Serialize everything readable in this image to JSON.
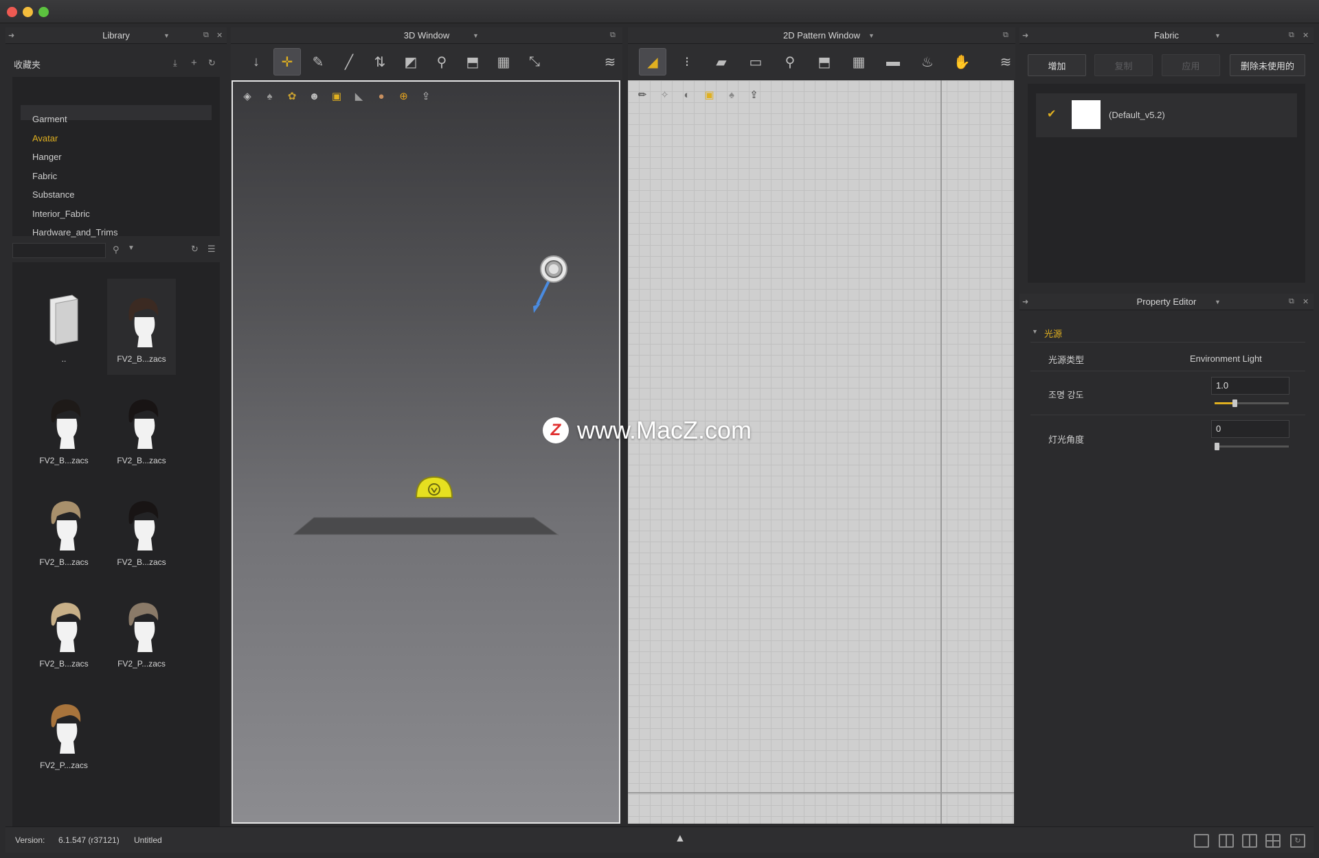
{
  "library": {
    "title": "Library",
    "favorites_label": "收藏夹",
    "categories": [
      "Garment",
      "Avatar",
      "Hanger",
      "Fabric",
      "Substance",
      "Interior_Fabric",
      "Hardware_and_Trims"
    ],
    "selected_category": "Avatar",
    "search_placeholder": "",
    "items": [
      {
        "label": ".."
      },
      {
        "label": "FV2_B...zacs"
      },
      {
        "label": "FV2_B...zacs"
      },
      {
        "label": "FV2_B...zacs"
      },
      {
        "label": "FV2_B...zacs"
      },
      {
        "label": "FV2_B...zacs"
      },
      {
        "label": "FV2_B...zacs"
      },
      {
        "label": "FV2_P...zacs"
      },
      {
        "label": "FV2_P...zacs"
      }
    ]
  },
  "window3d": {
    "title": "3D Window"
  },
  "window2d": {
    "title": "2D Pattern Window"
  },
  "fabric": {
    "title": "Fabric",
    "buttons": {
      "add": "增加",
      "copy": "复制",
      "apply": "应用",
      "delete_unused": "删除未使用的"
    },
    "items": [
      {
        "name": "(Default_v5.2)",
        "checked": true
      }
    ]
  },
  "property_editor": {
    "title": "Property Editor",
    "section": "光源",
    "rows": {
      "light_type_label": "光源类型",
      "light_type_value": "Environment Light",
      "intensity_label": "조명 강도",
      "intensity_value": "1.0",
      "angle_label": "灯光角度",
      "angle_value": "0"
    },
    "intensity_fraction": 0.27,
    "angle_fraction": 0.0
  },
  "watermark": "www.MacZ.com",
  "status": {
    "version_label": "Version:",
    "version_value": "6.1.547 (r37121)",
    "file_name": "Untitled"
  },
  "colors": {
    "accent": "#e0b020",
    "viewport_top": "#3a3a3d",
    "viewport_bottom": "#8a8a8e",
    "grid_bg": "#cfcfcf"
  }
}
